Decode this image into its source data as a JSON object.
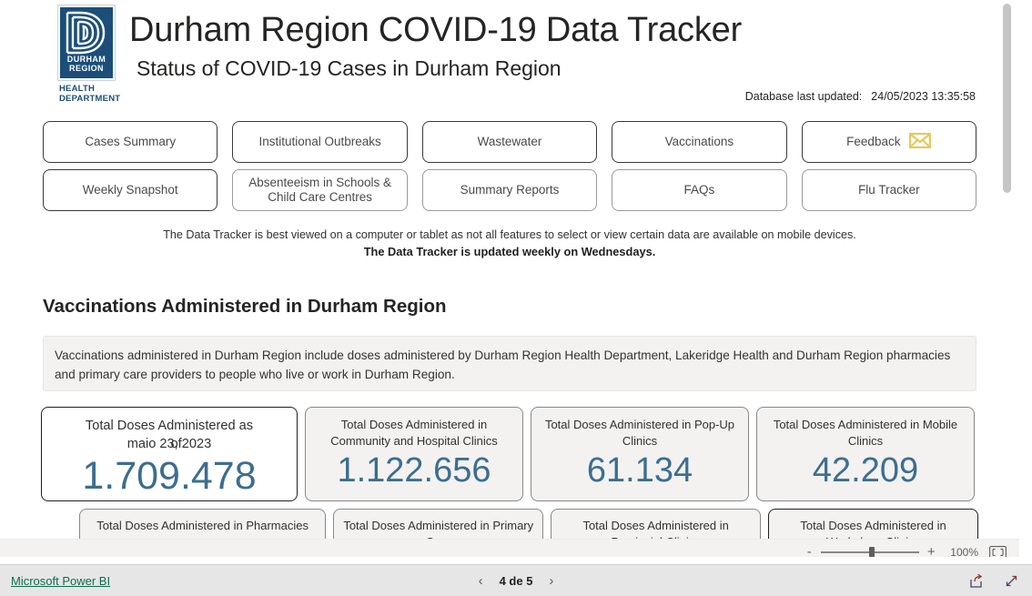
{
  "header": {
    "logo": {
      "line1": "DURHAM",
      "line2": "REGION",
      "sub": "HEALTH\nDEPARTMENT",
      "sub_line1": "HEALTH",
      "sub_line2": "DEPARTMENT",
      "color": "#1b4e79"
    },
    "title": "Durham Region COVID-19 Data Tracker",
    "subtitle": "Status of COVID-19 Cases in Durham Region",
    "db_updated_label": "Database last updated:",
    "db_updated_value": "24/05/2023 13:35:58"
  },
  "nav": {
    "row1": [
      {
        "label": "Cases Summary",
        "style": "dark",
        "icon": ""
      },
      {
        "label": "Institutional Outbreaks",
        "style": "dark",
        "icon": ""
      },
      {
        "label": "Wastewater",
        "style": "dark",
        "icon": ""
      },
      {
        "label": "Vaccinations",
        "style": "dark",
        "icon": ""
      },
      {
        "label": "Feedback",
        "style": "dark",
        "icon": "envelope-icon"
      }
    ],
    "row2": [
      {
        "label": "Weekly Snapshot",
        "style": "dark",
        "icon": ""
      },
      {
        "label": "Absenteeism in Schools & Child Care Centres",
        "style": "light",
        "icon": ""
      },
      {
        "label": "Summary Reports",
        "style": "light",
        "icon": ""
      },
      {
        "label": "FAQs",
        "style": "light",
        "icon": ""
      },
      {
        "label": "Flu Tracker",
        "style": "light",
        "icon": ""
      }
    ]
  },
  "notes": {
    "line1": "The Data Tracker is best viewed on a computer or tablet as not all features to select or view certain data are available on mobile devices.",
    "line2": "The Data Tracker is updated weekly on Wednesdays."
  },
  "section": {
    "title": "Vaccinations Administered in Durham Region",
    "blurb": "Vaccinations administered in Durham Region include doses administered by Durham Region Health Department, Lakeridge Health and Durham Region pharmacies and primary care providers to people who live or work in Durham Region."
  },
  "cards": {
    "row1": [
      {
        "label_line1": "Total Doses Administered as",
        "label_line2": "maio 23, 2023",
        "label_overlap": "of",
        "value": "1.709.478",
        "featured": true
      },
      {
        "label": "Total Doses Administered in Community and Hospital Clinics",
        "value": "1.122.656",
        "featured": false
      },
      {
        "label": "Total Doses Administered in Pop-Up Clinics",
        "value": "61.134",
        "featured": false
      },
      {
        "label": "Total Doses Administered in Mobile Clinics",
        "value": "42.209",
        "featured": false
      }
    ],
    "row2": [
      {
        "label": "Total Doses Administered in Pharmacies",
        "featured": false
      },
      {
        "label": "Total Doses Administered in Primary Care",
        "featured": false
      },
      {
        "label": "Total Doses Administered in Provincial Clinics",
        "featured": false
      },
      {
        "label": "Total Doses Administered in Workplace Clinics",
        "featured": true
      }
    ]
  },
  "zoombar": {
    "minus": "-",
    "plus": "+",
    "percent": "100%",
    "fit_icon": "fit-to-page-icon"
  },
  "statusbar": {
    "link": "Microsoft Power BI",
    "prev_icon": "chevron-left-icon",
    "page_text": "4 de 5",
    "next_icon": "chevron-right-icon",
    "share_icon": "share-icon",
    "fullscreen_icon": "fullscreen-icon"
  }
}
